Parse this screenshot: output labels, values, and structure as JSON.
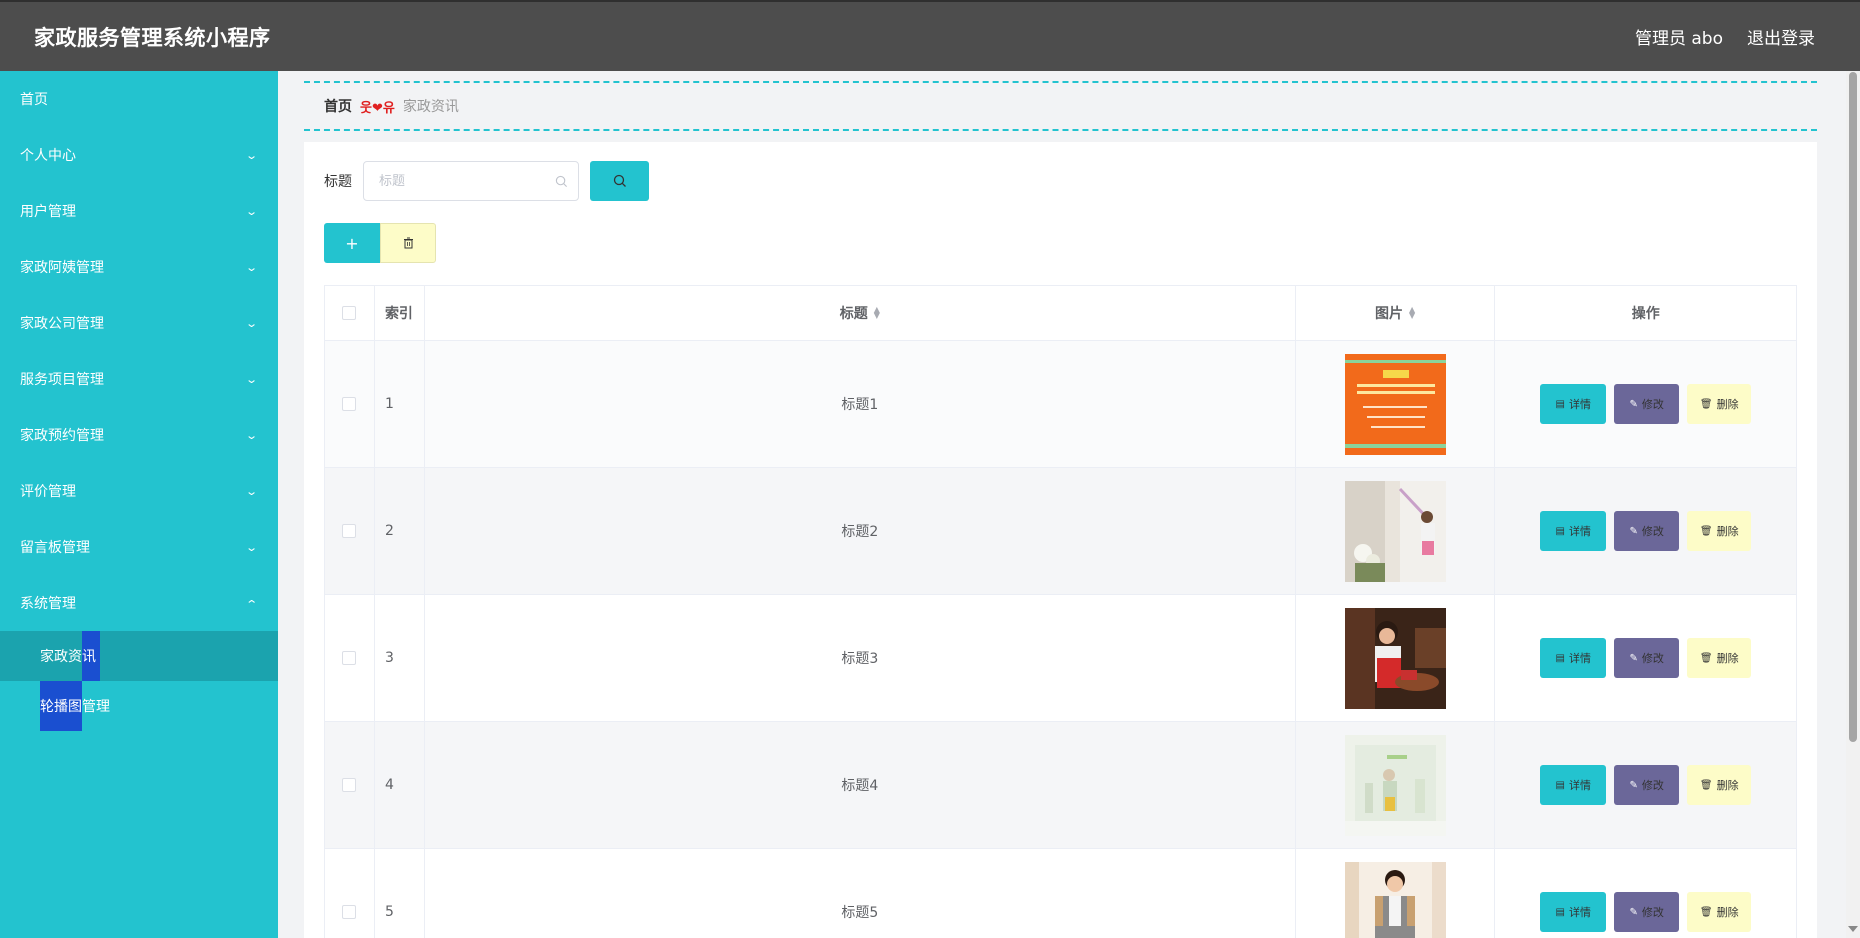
{
  "header": {
    "title": "家政服务管理系统小程序",
    "admin_label": "管理员 abo",
    "logout_label": "退出登录"
  },
  "sidebar": {
    "items": [
      {
        "label": "首页"
      },
      {
        "label": "个人中心"
      },
      {
        "label": "用户管理"
      },
      {
        "label": "家政阿姨管理"
      },
      {
        "label": "家政公司管理"
      },
      {
        "label": "服务项目管理"
      },
      {
        "label": "家政预约管理"
      },
      {
        "label": "评价管理"
      },
      {
        "label": "留言板管理"
      },
      {
        "label": "系统管理"
      }
    ],
    "sub_items": [
      {
        "label": "家政资讯"
      },
      {
        "label": "轮播图管理"
      }
    ]
  },
  "breadcrumb": {
    "home": "首页",
    "separator": "웃❤유",
    "current": "家政资讯"
  },
  "search": {
    "label": "标题",
    "placeholder": "标题"
  },
  "table": {
    "headers": {
      "index": "索引",
      "title": "标题",
      "image": "图片",
      "actions": "操作"
    },
    "rows": [
      {
        "index": "1",
        "title": "标题1"
      },
      {
        "index": "2",
        "title": "标题2"
      },
      {
        "index": "3",
        "title": "标题3"
      },
      {
        "index": "4",
        "title": "标题4"
      },
      {
        "index": "5",
        "title": "标题5"
      }
    ],
    "action_labels": {
      "detail": "详情",
      "edit": "修改",
      "delete": "删除"
    }
  },
  "colors": {
    "header_bg": "#4d4d4d",
    "sidebar_bg": "#23c3cf",
    "sidebar_active": "#1ba3ae",
    "primary": "#23c3cf",
    "edit_btn": "#6b6799",
    "delete_btn": "#fdfcc8"
  }
}
